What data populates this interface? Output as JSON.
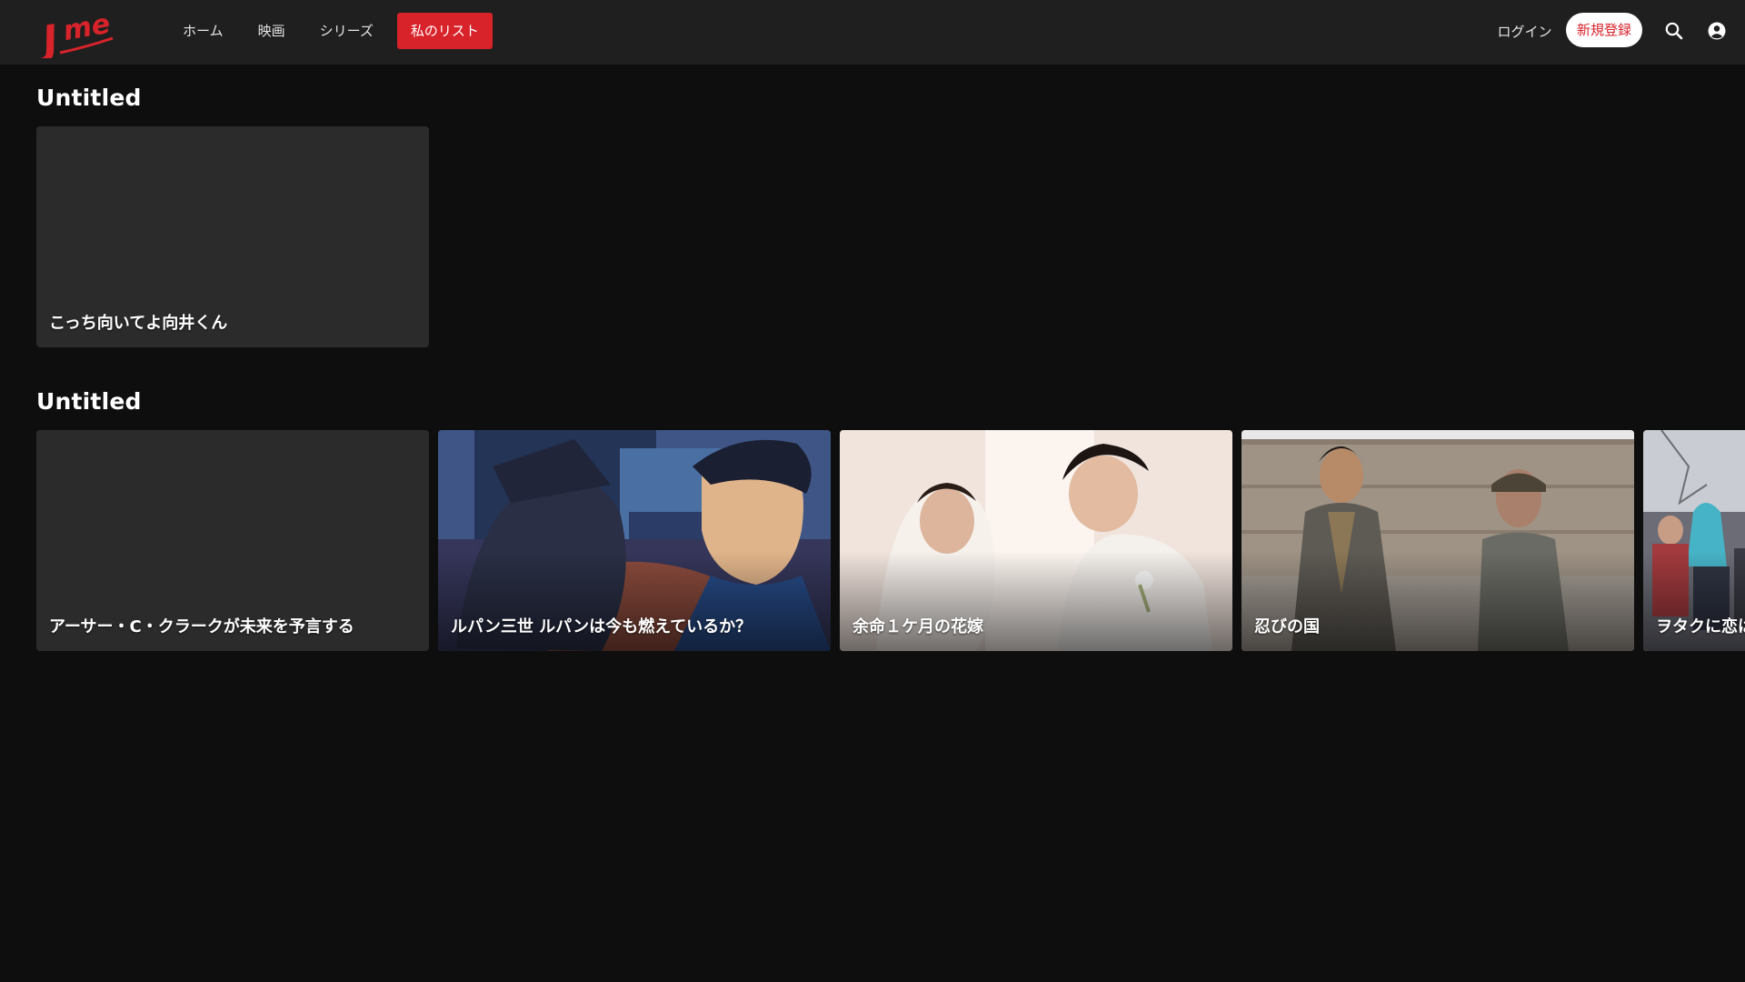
{
  "header": {
    "logo_text": "Jme",
    "nav": [
      {
        "label": "ホーム"
      },
      {
        "label": "映画"
      },
      {
        "label": "シリーズ"
      },
      {
        "label": "私のリスト",
        "active": true
      }
    ],
    "login_label": "ログイン",
    "signup_label": "新規登録",
    "icons": [
      "search-icon",
      "account-icon"
    ]
  },
  "colors": {
    "accent": "#d8232a",
    "background": "#0e0e0e",
    "header_bg": "#1f1f1f",
    "card_placeholder": "#2b2b2b"
  },
  "sections": [
    {
      "title": "Untitled",
      "items": [
        {
          "title": "こっち向いてよ向井くん"
        }
      ]
    },
    {
      "title": "Untitled",
      "items": [
        {
          "title": "アーサー・C・クラークが未来を予言する"
        },
        {
          "title": "ルパン三世 ルパンは今も燃えているか？"
        },
        {
          "title": "余命１ケ月の花嫁"
        },
        {
          "title": "忍びの国"
        },
        {
          "title": "ヲタクに恋は難しい"
        }
      ]
    }
  ]
}
